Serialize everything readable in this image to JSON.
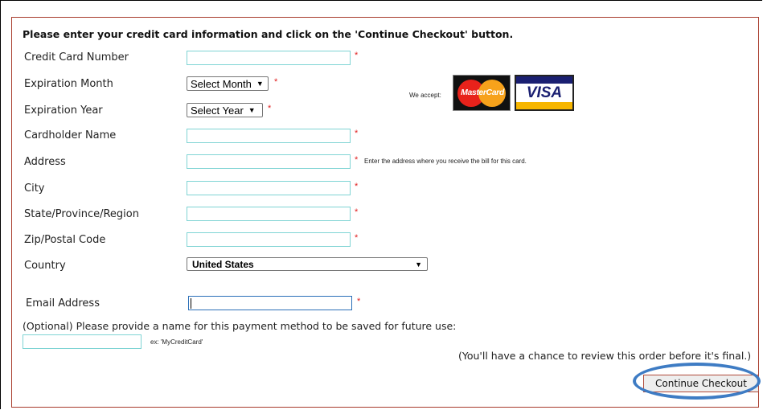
{
  "form": {
    "heading": "Please enter your credit card information and click on the 'Continue Checkout' button.",
    "required_mark": "*",
    "labels": {
      "card_number": "Credit Card Number",
      "exp_month": "Expiration Month",
      "exp_year": "Expiration Year",
      "cardholder": "Cardholder Name",
      "address": "Address",
      "city": "City",
      "state": "State/Province/Region",
      "zip": "Zip/Postal Code",
      "country": "Country",
      "email": "Email Address"
    },
    "exp_month_select": {
      "value": "Select Month"
    },
    "exp_year_select": {
      "value": "Select Year"
    },
    "country_select": {
      "value": "United States"
    },
    "values": {
      "card_number": "",
      "cardholder": "",
      "address": "",
      "city": "",
      "state": "",
      "zip": "",
      "email": "",
      "optional_name": ""
    },
    "address_hint": "Enter the address where you receive the bill for this card.",
    "optional_label": "(Optional) Please provide a name for this payment method to be saved for future use:",
    "optional_example": "ex: 'MyCreditCard'",
    "review_note": "(You'll have a chance to review this order before it's final.)",
    "continue_label": "Continue Checkout"
  },
  "accepted_cards": {
    "label": "We accept:",
    "mastercard": "MasterCard",
    "visa": "VISA"
  },
  "colors": {
    "required": "#e02020",
    "input_border": "#7fd4d4",
    "form_border": "#a83b2c",
    "highlight": "#3e7cc4",
    "visa_blue": "#1a1f71",
    "visa_gold": "#f7b600",
    "mc_red": "#e8221b",
    "mc_orange": "#f7a21b"
  },
  "icons": {
    "dropdown": "chevron-down-icon",
    "mastercard": "mastercard-logo-icon",
    "visa": "visa-logo-icon"
  }
}
